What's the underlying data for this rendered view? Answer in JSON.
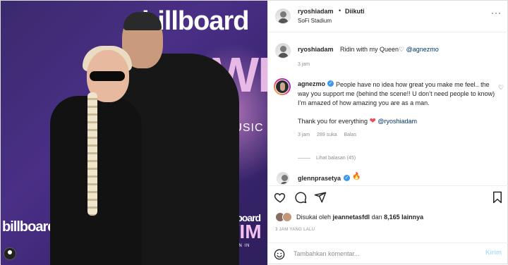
{
  "photo": {
    "billboard_top": "billboard",
    "wim_big": "WIM",
    "music_text": "MUSIC",
    "billboard_mid": "billboard",
    "wim_small": "WIM",
    "wim_sub": "WOMEN IN MUSIC",
    "billboard_left": "billboard"
  },
  "header": {
    "username": "ryoshiadam",
    "separator": "•",
    "follow_status": "Diikuti",
    "location": "SoFi Stadium",
    "more": "···"
  },
  "caption": {
    "username": "ryoshiadam",
    "text": "Ridin with my Queen",
    "heart": "♡",
    "mention": "@agnezmo",
    "time": "3 jam"
  },
  "comment": {
    "username": "agnezmo",
    "text": "People have no idea how great you make me feel.. the way you support me (behind the scene!! U don’t need people to know) I’m amazed of how amazing you are as a man.",
    "thanks": "Thank you for everything",
    "thanks_heart": "❤",
    "thanks_mention": "@ryoshiadam",
    "time": "3 jam",
    "likes": "289 suka",
    "reply": "Balas",
    "like_icon": "♡",
    "view_replies": "Lihat balasan (45)"
  },
  "comment2": {
    "username": "glennprasetya",
    "emoji": "🔥"
  },
  "likes": {
    "prefix": "Disukai oleh",
    "user": "jeannetasfdl",
    "connector": "dan",
    "others": "8,165 lainnya"
  },
  "post_date": "3 JAM YANG LALU",
  "comment_box": {
    "placeholder": "Tambahkan komentar...",
    "post_label": "Kirim"
  },
  "icons": {
    "heart": "heart-icon",
    "comment": "comment-icon",
    "share": "share-icon",
    "save": "bookmark-icon",
    "emoji": "emoji-icon",
    "verified": "verified-badge-icon"
  },
  "colors": {
    "link": "#00376b",
    "verified": "#3897f0",
    "post_disabled": "#b2dffc",
    "heart_red": "#ed4956"
  }
}
